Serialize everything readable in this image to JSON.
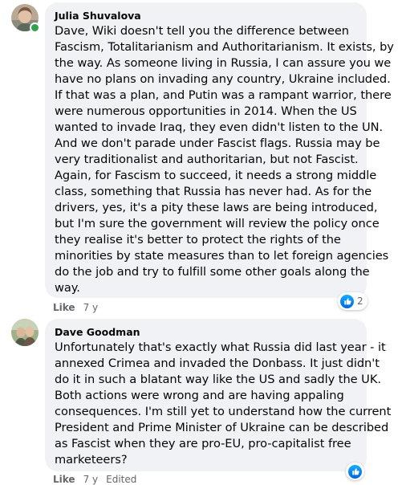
{
  "comments": [
    {
      "author": "Julia Shuvalova",
      "lines": [
        "Dave, Wiki doesn't tell you the difference between",
        "Fascism, Totalitarianism and Authoritarianism. It exists, by",
        "the way. As someone living in Russia, I can assure you we",
        "have no plans on invading any country, Ukraine included.",
        "If that was a plan, and Putin was a rampant warrior, there",
        "were numerous opportunities in 2014. When the US",
        "wanted to invade Iraq, they even didn't listen to the UN.",
        "And we don't parade under Fascist flags. Russia may be",
        "very traditionalist and authoritarian, but not Fascist.",
        "Again, for Fascism to succeed, it needs a strong middle",
        "class, something that Russia has never had. As for the",
        "drivers, yes, it's a pity these laws are being introduced,",
        "but I'm sure the government will review the policy once",
        "they realise it's better to protect the rights of the",
        "minorities by state measures than to let foreign agencies",
        "do the job and try to fulfill some other goals along the",
        "way."
      ],
      "reaction_count": "2",
      "like_label": "Like",
      "time": "7 y",
      "online": true
    },
    {
      "author": "Dave Goodman",
      "lines": [
        "Unfortunately that's exactly what Russia did last year - it",
        "annexed Crimea and invaded the Donbass. It just didn't",
        "do it in such a blatant way like the US and sadly the UK.",
        "Both actions were wrong and are having appaling",
        "consequences. I'm still yet to understand how the current",
        "President and Prime Minister of Ukraine can be described",
        "as Fascist when they are pro-EU, pro-capitalist free",
        "marketeers?"
      ],
      "reaction_count": "",
      "like_label": "Like",
      "time": "7 y",
      "edited": "Edited"
    }
  ],
  "colors": {
    "bubble": "#f0f2f5",
    "text": "#050505",
    "meta": "#65676b",
    "like_blue": "#1877f2",
    "online": "#31a24c"
  }
}
